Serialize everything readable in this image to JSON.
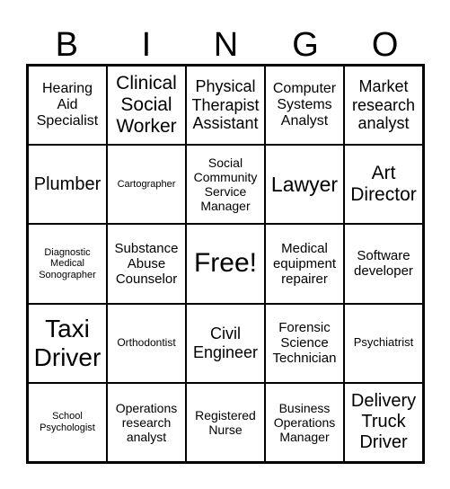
{
  "header": [
    "B",
    "I",
    "N",
    "G",
    "O"
  ],
  "cells": [
    "Hearing Aid Specialist",
    "Clinical Social Worker",
    "Physical Therapist Assistant",
    "Computer Systems Analyst",
    "Market research analyst",
    "Plumber",
    "Cartographer",
    "Social Community Service Manager",
    "Lawyer",
    "Art Director",
    "Diagnostic Medical Sonographer",
    "Substance Abuse Counselor",
    "Free!",
    "Medical equipment repairer",
    "Software developer",
    "Taxi Driver",
    "Orthodontist",
    "Civil Engineer",
    "Forensic Science Technician",
    "Psychiatrist",
    "School Psychologist",
    "Operations research analyst",
    "Registered Nurse",
    "Business Operations Manager",
    "Delivery Truck Driver"
  ]
}
